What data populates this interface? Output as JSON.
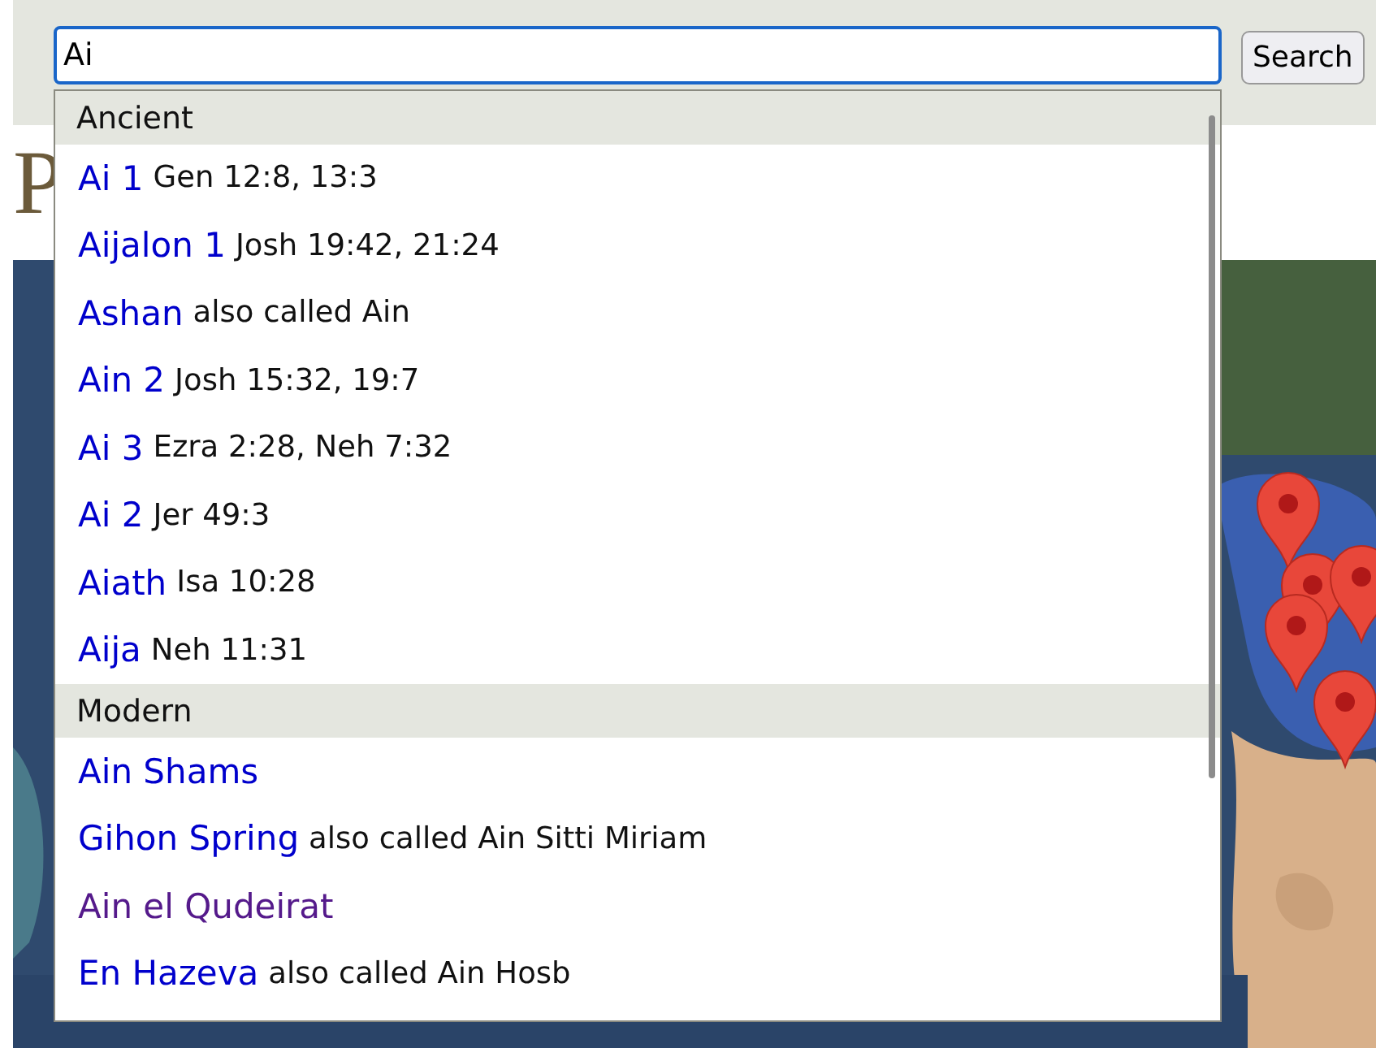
{
  "search": {
    "value": "Ai",
    "button": "Search"
  },
  "page": {
    "heading": "P"
  },
  "suggestions": [
    {
      "group": "Ancient",
      "items": [
        {
          "name": "Ai 1",
          "note": "Gen 12:8, 13:3",
          "visited": false
        },
        {
          "name": "Aijalon 1",
          "note": "Josh 19:42, 21:24",
          "visited": false
        },
        {
          "name": "Ashan",
          "note": "also called Ain",
          "visited": false
        },
        {
          "name": "Ain 2",
          "note": "Josh 15:32, 19:7",
          "visited": false
        },
        {
          "name": "Ai 3",
          "note": "Ezra 2:28, Neh 7:32",
          "visited": false
        },
        {
          "name": "Ai 2",
          "note": "Jer 49:3",
          "visited": false
        },
        {
          "name": "Aiath",
          "note": "Isa 10:28",
          "visited": false
        },
        {
          "name": "Aija",
          "note": "Neh 11:31",
          "visited": false
        }
      ]
    },
    {
      "group": "Modern",
      "items": [
        {
          "name": "Ain Shams",
          "visited": false
        },
        {
          "name": "Gihon Spring",
          "note": "also called Ain Sitti Miriam",
          "visited": false
        },
        {
          "name": "Ain el Qudeirat",
          "visited": true
        },
        {
          "name": "En Hazeva",
          "note": "also called Ain Hosb",
          "visited": false
        }
      ]
    }
  ]
}
